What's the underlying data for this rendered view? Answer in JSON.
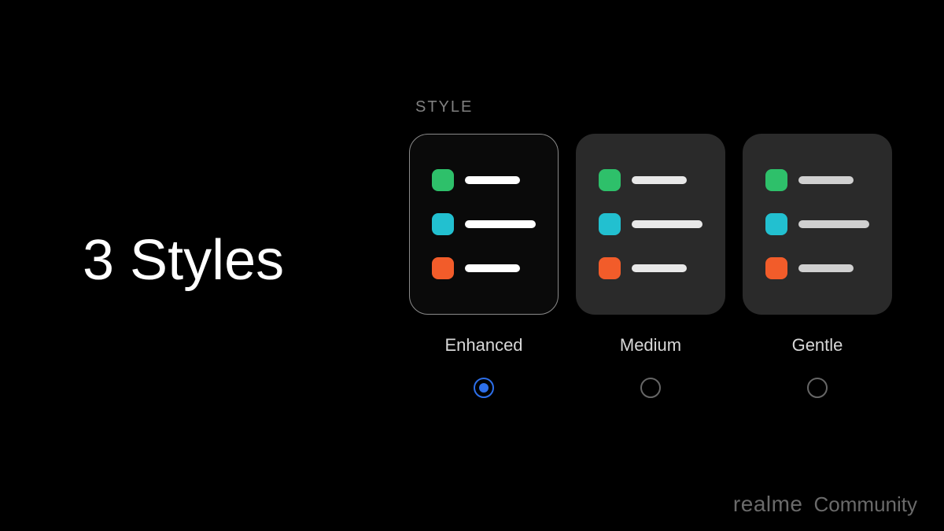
{
  "title": "3 Styles",
  "section_label": "STYLE",
  "styles": [
    {
      "name": "Enhanced",
      "selected": true
    },
    {
      "name": "Medium",
      "selected": false
    },
    {
      "name": "Gentle",
      "selected": false
    }
  ],
  "swatch_colors": {
    "green": "#2ec06a",
    "cyan": "#22c0d0",
    "orange": "#f25c2a"
  },
  "bar_widths": {
    "row1": 70,
    "row2": 90,
    "row3": 70
  },
  "watermark": {
    "brand": "realme",
    "sub": "Community"
  }
}
